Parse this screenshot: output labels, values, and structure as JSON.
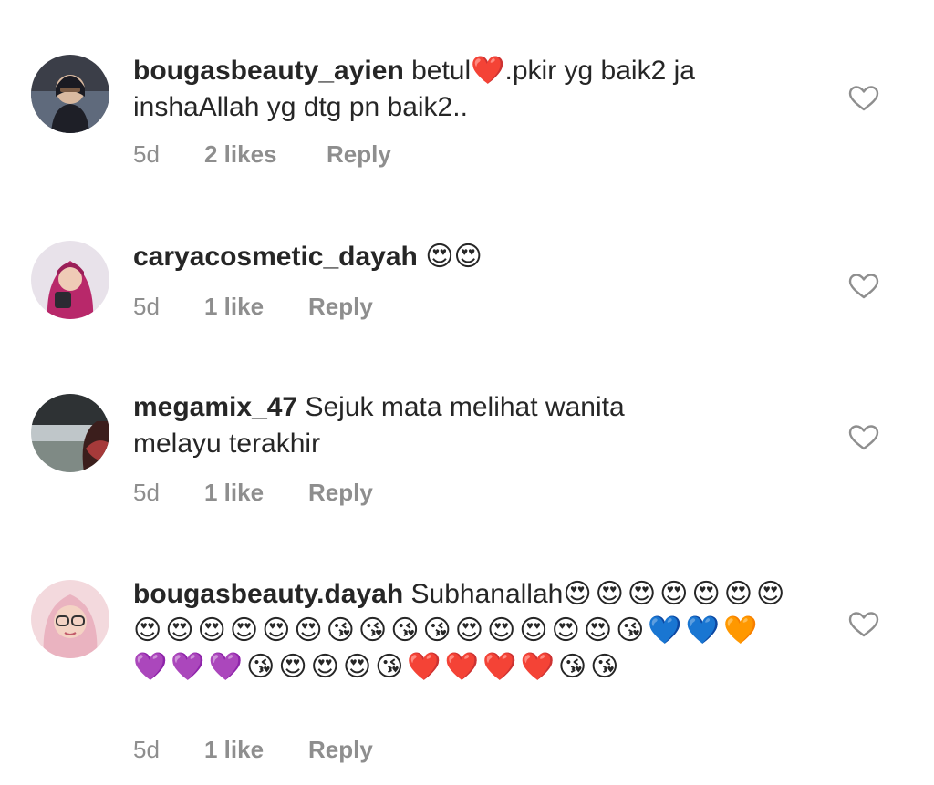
{
  "comments": [
    {
      "username": "bougasbeauty_ayien",
      "text_before": " betul",
      "text_emoji": "❤️",
      "text_after": ".pkir yg baik2 ja inshaAllah yg dtg pn baik2..",
      "time": "5d",
      "likes": "2 likes",
      "reply": "Reply",
      "like_icon": "heart-outline-icon"
    },
    {
      "username": "caryacosmetic_dayah",
      "text_before": " ",
      "text_emoji": "😍😍",
      "text_after": "",
      "time": "5d",
      "likes": "1 like",
      "reply": "Reply",
      "like_icon": "heart-outline-icon"
    },
    {
      "username": "megamix_47",
      "text_before": " Sejuk mata melihat wanita melayu terakhir",
      "text_emoji": "",
      "text_after": "",
      "time": "5d",
      "likes": "1 like",
      "reply": "Reply",
      "like_icon": "heart-outline-icon"
    },
    {
      "username": "bougasbeauty.dayah",
      "text_before": " Subhanallah",
      "text_emoji": "😍😍😍😍😍😍😍😍😍😍😍😍😍😘😘😘😘😍😍😍😍😍😘💙💙🧡💜💜💜😘😍😍😍😘❤️❤️❤️❤️😘😘",
      "text_after": "",
      "time": "5d",
      "likes": "1 like",
      "reply": "Reply",
      "like_icon": "heart-outline-icon"
    }
  ],
  "colors": {
    "text": "#262626",
    "meta": "#8e8e8e",
    "background": "#ffffff"
  }
}
